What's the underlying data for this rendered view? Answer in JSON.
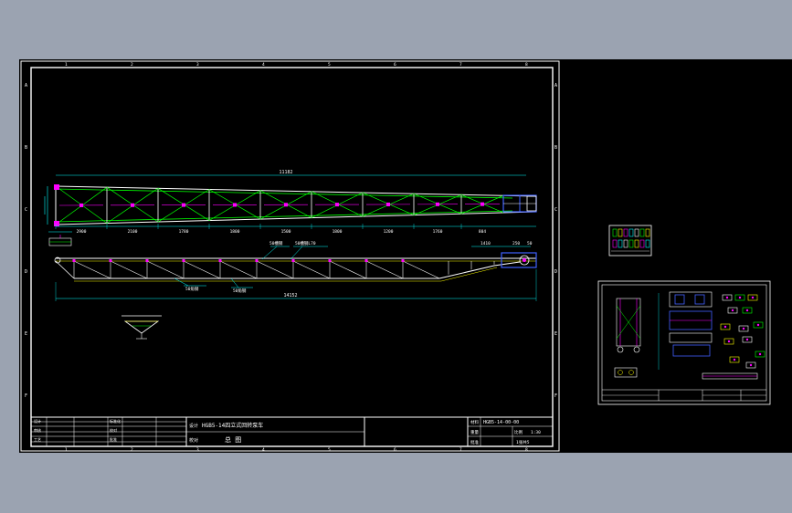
{
  "drawing": {
    "title_main": "HGB5-14四立式回转泵车",
    "title_main_prefix": "HGB5-14",
    "title_main_cn": "四立式回转泵车",
    "title_sub": "总 图",
    "drawing_no": "HGB5-14-00-00",
    "scale": "1:30",
    "sheet_label": "1张共5"
  },
  "dims": {
    "overall_top": "11182",
    "overall_bottom": "14152",
    "seg_1": "2900",
    "seg_2": "2100",
    "seg_3": "1780",
    "seg_4": "1800",
    "seg_5": "1500",
    "seg_6": "1800",
    "seg_7": "1200",
    "seg_8": "1760",
    "seg_9": "804",
    "right_top": "1410",
    "right_b1": "250",
    "right_b2": "50",
    "callout_1": "50槽钢",
    "callout_2": "50槽钢L70",
    "callout_3": "50角钢",
    "callout_4": "50角钢"
  },
  "border_letters": [
    "A",
    "B",
    "C",
    "D",
    "E",
    "F"
  ],
  "border_numbers": [
    "1",
    "2",
    "3",
    "4",
    "5",
    "6",
    "7",
    "8"
  ],
  "title_block_labels": {
    "design": "设计",
    "check": "校对",
    "audit": "审核",
    "process": "工艺",
    "std": "标准化",
    "approve": "批准",
    "material": "材料",
    "weight": "重量",
    "ratio": "比例"
  },
  "colors": {
    "background": "#000000",
    "frame": "#ffffff",
    "structure": "#00ff00",
    "outline": "#ffffff",
    "accent": "#ff00ff",
    "dim": "#00ffff",
    "highlight": "#ffff00",
    "blue": "#4060ff",
    "red": "#ff2020"
  }
}
